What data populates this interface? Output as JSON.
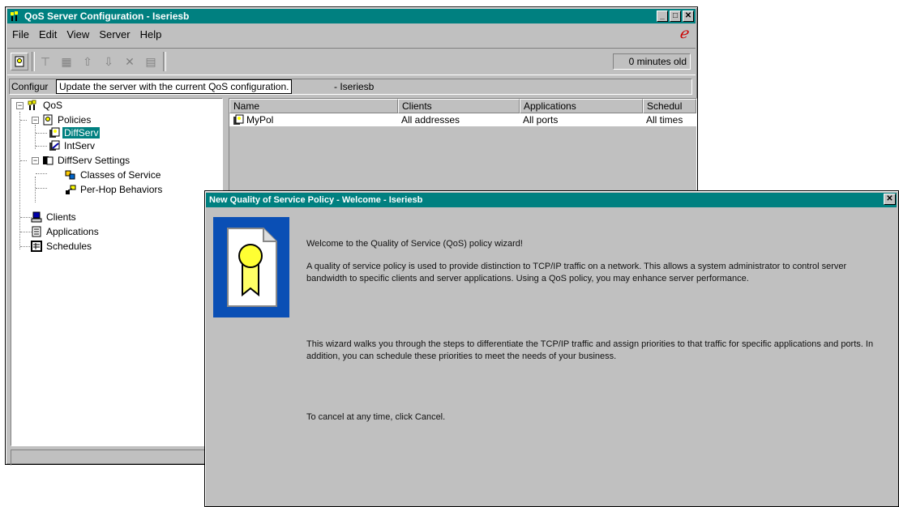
{
  "main_window": {
    "title": "QoS Server Configuration - Iseriesb",
    "menus": [
      "File",
      "Edit",
      "View",
      "Server",
      "Help"
    ],
    "toolbar_age": "0 minutes old",
    "path_label": "Configur",
    "path_tail": "- Iseriesb",
    "tooltip": "Update the server with the current QoS configuration."
  },
  "tree": {
    "root": "QoS",
    "policies": "Policies",
    "diffserv": "DiffServ",
    "intserv": "IntServ",
    "diffserv_settings": "DiffServ Settings",
    "classes": "Classes of Service",
    "phb": "Per-Hop Behaviors",
    "clients": "Clients",
    "applications": "Applications",
    "schedules": "Schedules"
  },
  "list": {
    "columns": [
      "Name",
      "Clients",
      "Applications",
      "Schedul"
    ],
    "rows": [
      {
        "name": "MyPol",
        "clients": "All addresses",
        "applications": "All ports",
        "schedule": "All times"
      }
    ]
  },
  "dialog": {
    "title": "New Quality of Service Policy - Welcome - Iseriesb",
    "welcome": "Welcome to the Quality of Service (QoS) policy wizard!",
    "para1": "A quality of service policy is used to provide distinction to TCP/IP traffic on a network. This allows a system administrator to control server bandwidth to specific clients and server applications. Using a QoS policy, you may enhance server performance.",
    "para2": "This wizard walks you through the steps to differentiate the TCP/IP traffic and assign priorities to that traffic for specific applications and ports. In addition, you can schedule these priorities to meet the needs of your business.",
    "para3": "To cancel at any time, click Cancel."
  },
  "colors": {
    "titlebar": "#008080",
    "face": "#c0c0c0",
    "accent_red": "#cc0000",
    "wizard_blue": "#0048b0"
  }
}
